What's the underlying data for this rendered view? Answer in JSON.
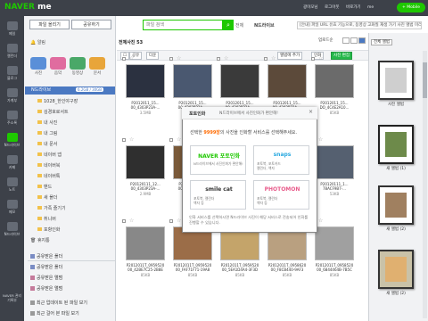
{
  "topbar": {
    "logo_brand": "NAVER",
    "logo_product": "me",
    "nav": [
      "광이모님",
      "로그아웃",
      "바로가기",
      "me"
    ],
    "mobile_label": "+ Mobile"
  },
  "search": {
    "placeholder": "파일 검색",
    "scope": "전체",
    "tag": "N드라이브"
  },
  "notice": "[안내] 파일 URL 유효 기능으로, 동영상 고화질 재생 가기 사진 앨범 미리",
  "rail": {
    "items": [
      "메일",
      "캘린더",
      "블로그",
      "가계부",
      "주소록",
      "N드라이브",
      "카페",
      "노트",
      "메모",
      "N드라이브"
    ],
    "bottom": "NAVER 관리기록부"
  },
  "sidebar": {
    "upload": "파일 올리기",
    "share": "공유하기",
    "alarm": "알림",
    "quick": [
      "사진",
      "음악",
      "동영상",
      "문서"
    ],
    "tree_header": "N드라이브",
    "quota": "6.2GB / 30GB",
    "folders": [
      "1028_한인야구장",
      "김경호로서트",
      "내 사진",
      "내 그림",
      "내 문서",
      "네이버 앱",
      "네이버북",
      "네이버툭",
      "밴드",
      "새 폴더",
      "가족 즐기기",
      "취니버",
      "포항인화",
      "휴지통"
    ],
    "categories": [
      "공유받은 폴더",
      "공유받은 폴더",
      "공유받은 앨범",
      "공유받은 앨범",
      "최근 업데이트 된 파일 보기",
      "최근 걸어 본 파일 보기"
    ]
  },
  "main": {
    "crumb": "전체사진 53",
    "sort": "업로드순",
    "toolbar": [
      "공유",
      "다운",
      "앨범에 추가",
      "인화",
      "사진 편집"
    ],
    "files": [
      [
        "P2012011_15...",
        "00_4303P23A-..."
      ],
      [
        "P2012011_15...",
        "00_4303P23A-..."
      ],
      [
        "P2012011_15...",
        "00_4303P23A-..."
      ],
      [
        "P2012011_15...",
        "00_4303P23A-..."
      ],
      [
        "P2012011_15...",
        "DO_4C4E2A10..."
      ],
      [
        "P20120111_12...",
        "00_4303P23A-..."
      ],
      [
        "P2012011_15...",
        "00_4303P23A-..."
      ],
      [
        "P2012011_10...",
        "00_4303P23A-..."
      ],
      [
        "P20120111_1000708...",
        "00_1F5C40AA6..."
      ],
      [
        "P20120111_1...",
        "78ACF9B7-..."
      ],
      [
        "P2012011T_0959520",
        "00_42BE7C25-2B8E"
      ],
      [
        "P2012011T_0959520",
        "00_FAF71F71-19A8"
      ],
      [
        "P2012011T_0959520",
        "00_5EA1D4A4-3F3D"
      ],
      [
        "P2012011T_0958620",
        "00_F8CB440-9AF3"
      ],
      [
        "P2012011T_0958520",
        "00_6844464B-7B5C"
      ]
    ],
    "sizes": [
      "3.5MB",
      "2.4MB",
      "3.1MB",
      "3.6MB",
      "85KB",
      "2.9MB",
      "1.1MB",
      "8.6MB",
      "1.9MB",
      "53KB",
      "85KB",
      "85KB",
      "85KB",
      "85KB",
      "85KB"
    ]
  },
  "rightpanel": {
    "title": "전체 앨범",
    "albums": [
      "사진 앨범",
      "새 앨범 (1)",
      "새 앨범 (2)",
      "새 앨범 (2)"
    ]
  },
  "modal": {
    "title": "포토인화",
    "subtitle": "N드라이브에서 사진인화가 편안해!",
    "message_pre": "선택한 ",
    "count": "9999장",
    "message_post": "의 사진을 인화할 서비스를 선택해주세요.",
    "services": [
      {
        "name": "NAVER 포토인화",
        "lines": [
          "N드라이브에서 사진인화가 편안해!"
        ]
      },
      {
        "name": "snaps",
        "lines": [
          "포토북, 포토카드",
          "캘린더, 액자"
        ]
      },
      {
        "name": "smile cat",
        "lines": [
          "포토북, 캘린더",
          "액자 등"
        ]
      },
      {
        "name": "PHOTOMON",
        "lines": [
          "포토북, 캘린더",
          "액자 등"
        ]
      }
    ],
    "footer": "인화 서비스를 선택하시면 N드라이브 사진이 해당 서비스로 전송되어 인화를 진행할 수 있습니다.",
    "close": "×"
  },
  "colors": {
    "naver_green": "#1ec800",
    "accent_blue": "#4b79c2",
    "highlight_orange": "#ff6a00"
  }
}
